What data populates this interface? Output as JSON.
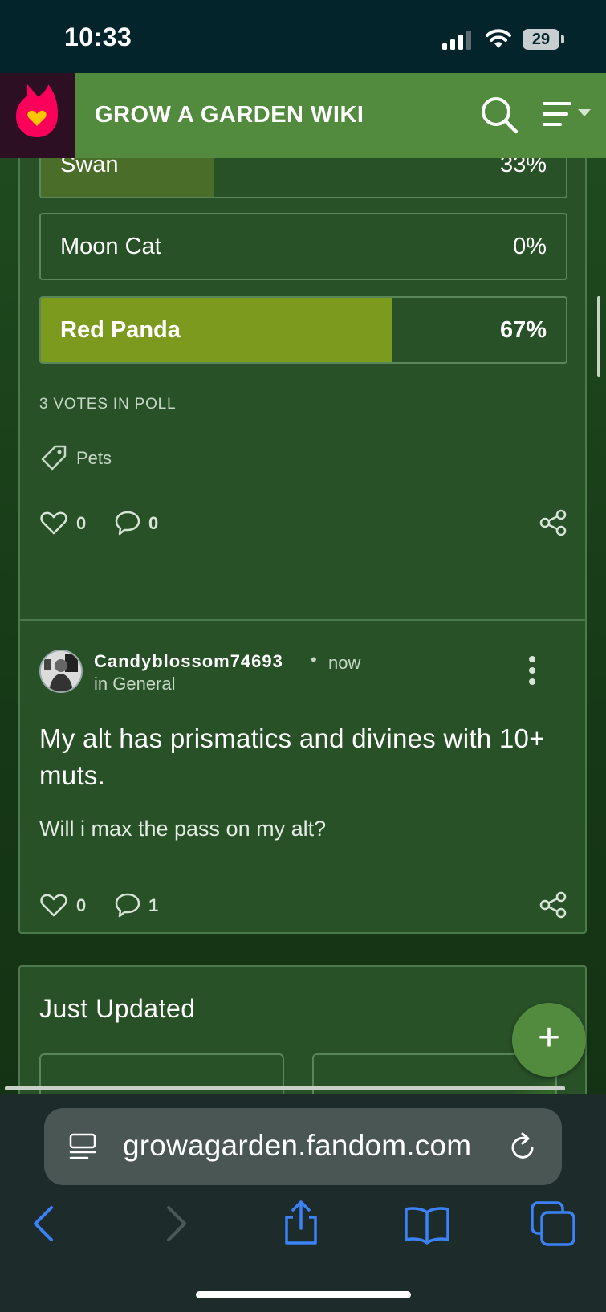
{
  "status_bar": {
    "time": "10:33",
    "battery": "29"
  },
  "nav": {
    "title": "GROW A GARDEN WIKI"
  },
  "poll": {
    "options": [
      {
        "label": "Swan",
        "percent": "33%",
        "fill": 0.33,
        "fill_color": "#4a6e2a"
      },
      {
        "label": "Moon Cat",
        "percent": "0%",
        "fill": 0.0,
        "fill_color": "#4a6e2a"
      },
      {
        "label": "Red Panda",
        "percent": "67%",
        "fill": 0.67,
        "fill_color": "#7c9a1e"
      }
    ],
    "votes": "3 VOTES IN POLL",
    "tag": "Pets",
    "likes": "0",
    "comments": "0"
  },
  "post": {
    "author": "Candyblossom74693",
    "separator": "•",
    "time": "now",
    "category": "in General",
    "title": "My alt has prismatics and divines with 10+ muts.",
    "body": "Will i max the pass on my alt?",
    "likes": "0",
    "comments": "1"
  },
  "just_updated": {
    "title": "Just Updated"
  },
  "fab": {
    "label": "+"
  },
  "browser": {
    "url": "growagarden.fandom.com"
  },
  "colors": {
    "nav_green": "#528a3e",
    "card_green": "#285128",
    "logo_bg": "#2c0f22",
    "logo_flame": "#fa005a"
  }
}
